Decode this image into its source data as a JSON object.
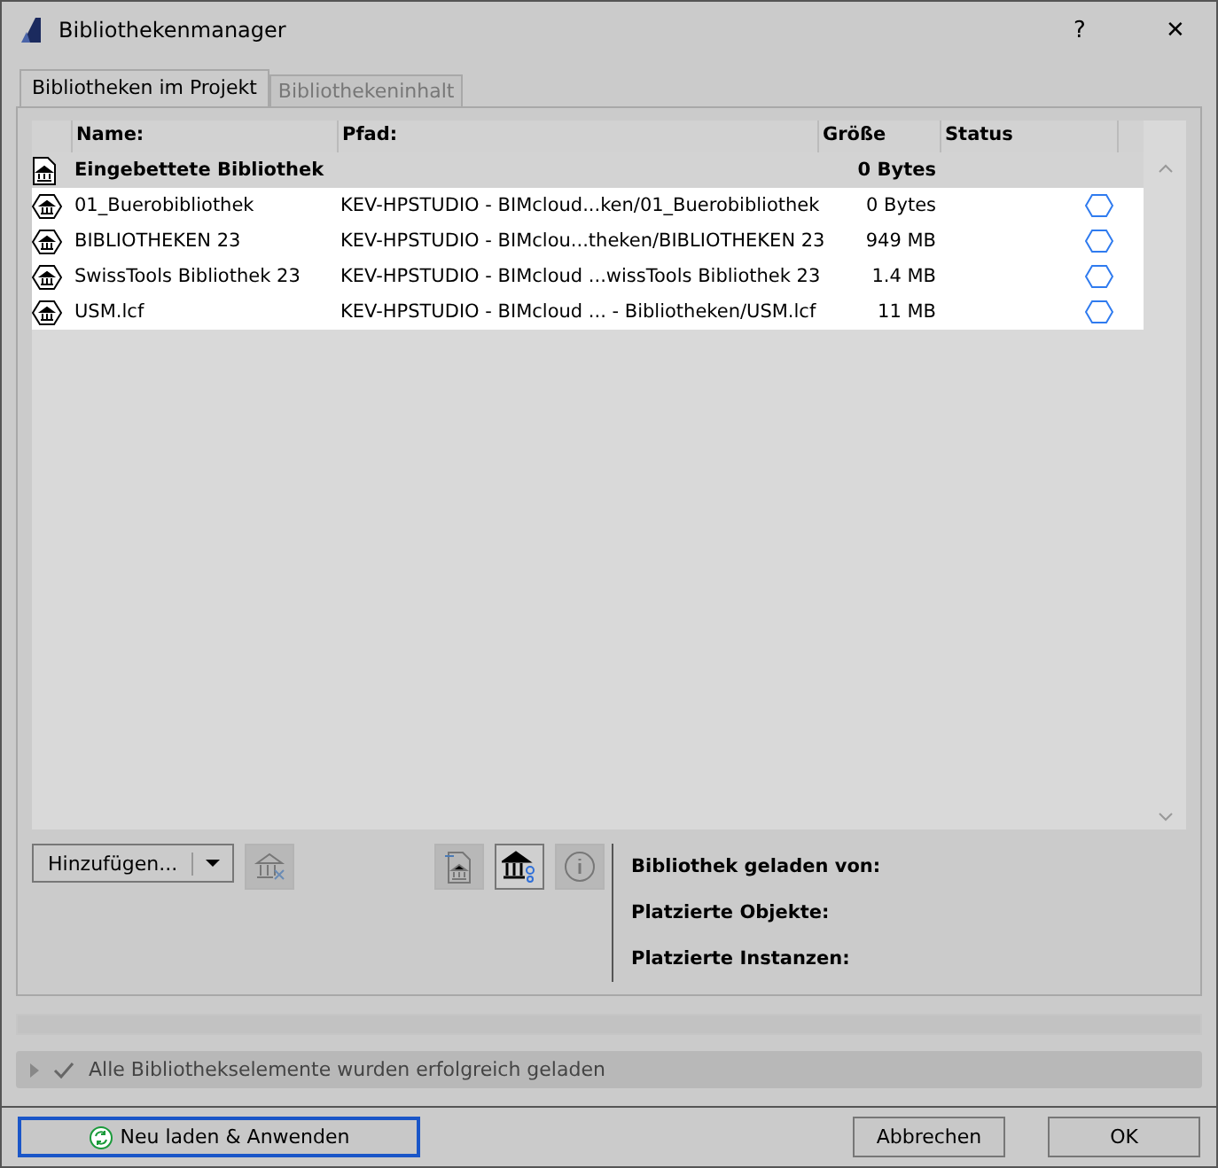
{
  "window": {
    "title": "Bibliothekenmanager",
    "help": "?",
    "close": "✕"
  },
  "tabs": [
    {
      "label": "Bibliotheken im Projekt",
      "selected": true
    },
    {
      "label": "Bibliothekeninhalt",
      "selected": false
    }
  ],
  "table": {
    "columns": [
      "Name:",
      "Pfad:",
      "Größe",
      "Status"
    ],
    "rows": [
      {
        "kind": "embedded",
        "name": "Eingebettete Bibliothek",
        "path": "",
        "size": "0 Bytes"
      },
      {
        "kind": "linked",
        "name": "01_Buerobibliothek",
        "path": "KEV-HPSTUDIO - BIMcloud...ken/01_Buerobibliothek",
        "size": "0 Bytes"
      },
      {
        "kind": "linked",
        "name": "BIBLIOTHEKEN 23",
        "path": "KEV-HPSTUDIO - BIMclou...theken/BIBLIOTHEKEN 23",
        "size": "949 MB"
      },
      {
        "kind": "linked",
        "name": "SwissTools Bibliothek 23",
        "path": "KEV-HPSTUDIO - BIMcloud ...wissTools Bibliothek 23",
        "size": "1.4 MB"
      },
      {
        "kind": "linked",
        "name": "USM.lcf",
        "path": "KEV-HPSTUDIO - BIMcloud ... - Bibliotheken/USM.lcf",
        "size": "11 MB"
      }
    ]
  },
  "add_button": {
    "label": "Hinzufügen..."
  },
  "tools": [
    {
      "kind": "remove",
      "disabled": true
    },
    {
      "kind": "embed",
      "disabled": true
    },
    {
      "kind": "manage",
      "disabled": false
    },
    {
      "kind": "info",
      "disabled": true
    }
  ],
  "info": [
    "Bibliothek geladen von:",
    "Platzierte Objekte:",
    "Platzierte Instanzen:"
  ],
  "progress": {
    "level": 0
  },
  "status_message": "Alle Bibliothekselemente wurden erfolgreich geladen",
  "buttons": [
    {
      "kind": "reload",
      "label": "Neu laden & Anwenden",
      "focused": true
    },
    {
      "kind": "plain",
      "label": "Abbrechen",
      "focused": false
    },
    {
      "kind": "plain",
      "label": "OK",
      "focused": false
    }
  ]
}
